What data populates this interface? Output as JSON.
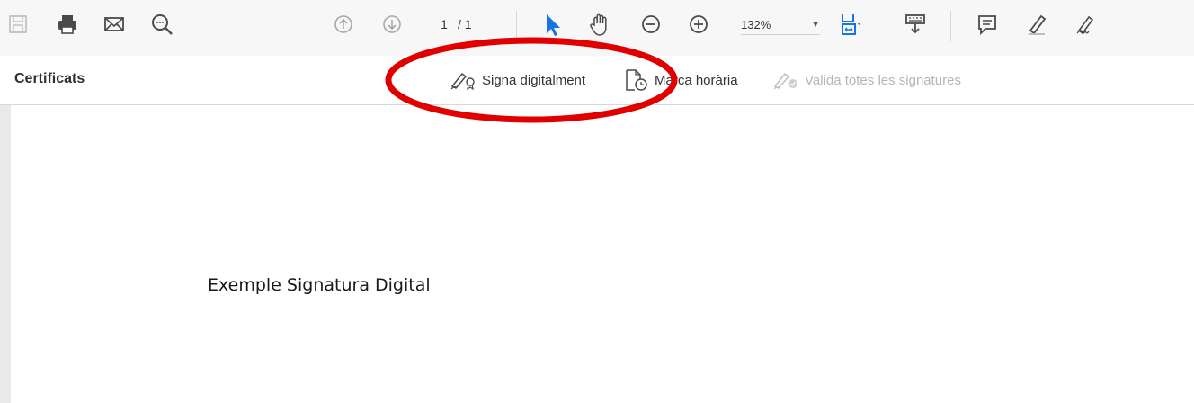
{
  "toolbar": {
    "page_current": "1",
    "page_total": "/ 1",
    "zoom": "132%",
    "icons": [
      "save-icon",
      "print-icon",
      "email-icon",
      "search-icon",
      "prev-page-icon",
      "next-page-icon",
      "select-pointer-icon",
      "hand-icon",
      "zoom-out-icon",
      "zoom-in-icon",
      "fit-width-icon",
      "keyboard-icon",
      "comment-icon",
      "highlight-icon",
      "fill-sign-icon"
    ]
  },
  "certbar": {
    "title": "Certificats",
    "actions": {
      "sign": "Signa digitalment",
      "timestamp": "Marca horària",
      "validate": "Valida totes les signatures"
    }
  },
  "document": {
    "text": "Exemple Signatura Digital"
  },
  "colors": {
    "accent_blue": "#1473e6",
    "annotation_red": "#e00000",
    "icon_gray": "#6e6e6e"
  }
}
